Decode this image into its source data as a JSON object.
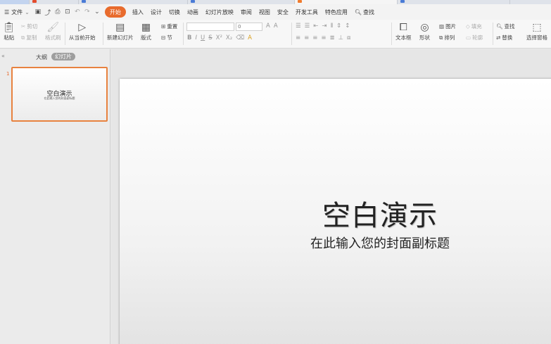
{
  "tabs": {
    "colors": [
      "#e34b2c",
      "#4a7bd6",
      "#4a7bd6",
      "#f07a2c",
      "#4a7bd6"
    ]
  },
  "menubar": {
    "file_label": "文件",
    "tabs": [
      "开始",
      "插入",
      "设计",
      "切换",
      "动画",
      "幻灯片放映",
      "审阅",
      "视图",
      "安全",
      "开发工具",
      "特色应用"
    ],
    "active_tab": "开始",
    "search_label": "查找"
  },
  "ribbon": {
    "paste": "粘贴",
    "cut": "剪切",
    "copy": "复制",
    "format_painter": "格式刷",
    "play_from_current": "从当前开始",
    "new_slide": "新建幻灯片",
    "layout": "版式",
    "reset": "重置",
    "section": "节",
    "font_size_value": "0",
    "textbox": "文本框",
    "shape": "形状",
    "picture": "图片",
    "arrange": "排列",
    "fill": "填充",
    "outline": "轮廓",
    "find": "查找",
    "replace": "替换",
    "select_pane": "选择窗格"
  },
  "sidebar": {
    "tab_outline": "大纲",
    "tab_slides": "幻灯片",
    "slide_number": "1",
    "thumb_title": "空白演示",
    "thumb_subtitle": "在此输入您的封面副标题"
  },
  "slide": {
    "title": "空白演示",
    "subtitle": "在此输入您的封面副标题"
  },
  "colors": {
    "accent": "#e86b2d",
    "selection_border": "#e8823f"
  }
}
